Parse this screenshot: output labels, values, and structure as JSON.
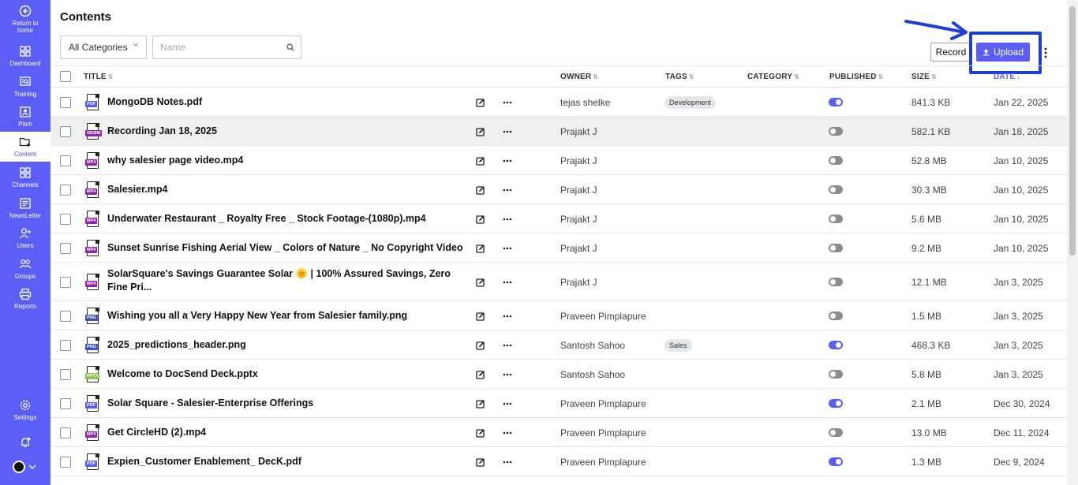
{
  "sidebar": {
    "items": [
      {
        "label": "Return to home",
        "icon": "arrow-left-circle-icon"
      },
      {
        "label": "Dashboard",
        "icon": "grid-icon"
      },
      {
        "label": "Training",
        "icon": "training-icon"
      },
      {
        "label": "Pitch",
        "icon": "pitch-icon"
      },
      {
        "label": "Content",
        "icon": "folder-plus-icon",
        "active": true
      },
      {
        "label": "Channels",
        "icon": "channels-grid-icon"
      },
      {
        "label": "NewsLetter",
        "icon": "newsletter-icon"
      },
      {
        "label": "Users",
        "icon": "user-plus-icon"
      },
      {
        "label": "Groups",
        "icon": "groups-icon"
      },
      {
        "label": "Reports",
        "icon": "printer-icon"
      }
    ],
    "settings_label": "Settings"
  },
  "header": {
    "title": "Contents",
    "category_select": "All Categories",
    "search_placeholder": "Name",
    "record_label": "Record",
    "upload_label": "Upload"
  },
  "table": {
    "columns": {
      "title": "TITLE",
      "owner": "OWNER",
      "tags": "TAGS",
      "category": "CATEGORY",
      "published": "PUBLISHED",
      "size": "SIZE",
      "date": "DATE"
    },
    "rows": [
      {
        "title": "MongoDB Notes.pdf",
        "type": "PDF",
        "owner": "tejas shelke",
        "tag": "Development",
        "published": true,
        "size": "841.3 KB",
        "date": "Jan 22, 2025"
      },
      {
        "title": "Recording Jan 18, 2025",
        "type": "WEBM",
        "owner": "Prajakt J",
        "tag": "",
        "published": false,
        "size": "582.1 KB",
        "date": "Jan 18, 2025"
      },
      {
        "title": "why salesier page video.mp4",
        "type": "MP4",
        "owner": "Prajakt J",
        "tag": "",
        "published": false,
        "size": "52.8 MB",
        "date": "Jan 10, 2025"
      },
      {
        "title": "Salesier.mp4",
        "type": "MP4",
        "owner": "Prajakt J",
        "tag": "",
        "published": false,
        "size": "30.3 MB",
        "date": "Jan 10, 2025"
      },
      {
        "title": "Underwater Restaurant _ Royalty Free _ Stock Footage-(1080p).mp4",
        "type": "MP4",
        "owner": "Prajakt J",
        "tag": "",
        "published": false,
        "size": "5.6 MB",
        "date": "Jan 10, 2025"
      },
      {
        "title": "Sunset Sunrise Fishing Aerial View _ Colors of Nature _ No Copyright Videos-(...",
        "type": "MP4",
        "owner": "Prajakt J",
        "tag": "",
        "published": false,
        "size": "9.2 MB",
        "date": "Jan 10, 2025"
      },
      {
        "title": "SolarSquare's Savings Guarantee Solar 🌞 | 100% Assured Savings, Zero Fine Pri...",
        "type": "MP4",
        "owner": "Prajakt J",
        "tag": "",
        "published": false,
        "size": "12.1 MB",
        "date": "Jan 3, 2025"
      },
      {
        "title": "Wishing you all a Very Happy New Year from Salesier family.png",
        "type": "PNG",
        "owner": "Praveen Pimplapure",
        "tag": "",
        "published": false,
        "size": "1.5 MB",
        "date": "Jan 3, 2025"
      },
      {
        "title": "2025_predictions_header.png",
        "type": "PNG",
        "owner": "Santosh Sahoo",
        "tag": "Sales",
        "published": true,
        "size": "468.3 KB",
        "date": "Jan 3, 2025"
      },
      {
        "title": "Welcome to DocSend Deck.pptx",
        "type": "PPTX",
        "owner": "Santosh Sahoo",
        "tag": "",
        "published": false,
        "size": "5.8 MB",
        "date": "Jan 3, 2025"
      },
      {
        "title": "Solar Square - Salesier-Enterprise Offerings",
        "type": "PDF",
        "owner": "Praveen Pimplapure",
        "tag": "",
        "published": true,
        "size": "2.1 MB",
        "date": "Dec 30, 2024"
      },
      {
        "title": "Get CircleHD (2).mp4",
        "type": "MP4",
        "owner": "Praveen Pimplapure",
        "tag": "",
        "published": false,
        "size": "13.0 MB",
        "date": "Dec 11, 2024"
      },
      {
        "title": "Expien_Customer Enablement_ DecK.pdf",
        "type": "PDF",
        "owner": "Praveen Pimplapure",
        "tag": "",
        "published": true,
        "size": "1.3 MB",
        "date": "Dec 9, 2024"
      }
    ]
  },
  "colors": {
    "brand": "#5b5ef6",
    "annotation": "#1f3fd1",
    "pdf": "#5b5ef6",
    "mp4": "#8e24aa",
    "webm": "#8e24aa",
    "png": "#3f51b5",
    "pptx": "#8bc34a"
  }
}
